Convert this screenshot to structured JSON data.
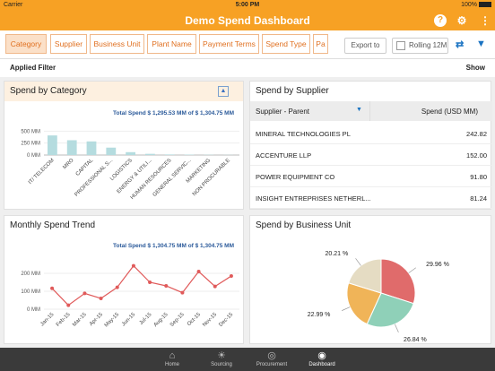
{
  "status": {
    "carrier": "Carrier",
    "time": "5:00 PM",
    "battery": "100%"
  },
  "header": {
    "title": "Demo Spend Dashboard",
    "icons": [
      "help-icon",
      "gear-icon",
      "more-vertical-icon"
    ],
    "accent": "#f7a124"
  },
  "filters": {
    "tabs": [
      "Category",
      "Supplier",
      "Business Unit",
      "Plant Name",
      "Payment Terms",
      "Spend Type",
      "Pa"
    ],
    "export_label": "Export to",
    "rolling_label": "Rolling 12M",
    "icons": [
      "swap-icon",
      "filter-icon"
    ]
  },
  "applied": {
    "label": "Applied Filter",
    "show_label": "Show"
  },
  "category_card": {
    "title": "Spend by Category",
    "total": "Total Spend $ 1,295.53 MM of $ 1,304.75 MM"
  },
  "supplier_card": {
    "title": "Spend by Supplier",
    "col1": "Supplier - Parent",
    "col2": "Spend (USD MM)",
    "rows": [
      {
        "name": "MINERAL TECHNOLOGIES PL",
        "value": "242.82"
      },
      {
        "name": "ACCENTURE LLP",
        "value": "152.00"
      },
      {
        "name": "POWER EQUIPMENT CO",
        "value": "91.80"
      },
      {
        "name": "INSIGHT ENTREPRISES NETHERL...",
        "value": "81.24"
      }
    ]
  },
  "trend_card": {
    "title": "Monthly Spend Trend",
    "total": "Total Spend $ 1,304.75 MM of $ 1,304.75 MM"
  },
  "bu_card": {
    "title": "Spend by Business Unit"
  },
  "chart_data": [
    {
      "type": "bar",
      "categories": [
        "IT/ TELECOM",
        "MRO",
        "CAPITAL",
        "PROFESSIONAL S...",
        "LOGISTICS",
        "ENERGY & UTILI...",
        "HUMAN RESOURCES",
        "GENERAL SERVIC...",
        "MARKETING",
        "NON PROCURABLE"
      ],
      "values": [
        410,
        310,
        285,
        155,
        60,
        25,
        12,
        8,
        5,
        3
      ],
      "yticks": [
        "0 MM",
        "250 MM",
        "500 MM"
      ],
      "ylim": [
        0,
        750
      ],
      "color": "#b5dcdf"
    },
    {
      "type": "line",
      "categories": [
        "Jan-15",
        "Feb-15",
        "Mar-15",
        "Apr-15",
        "May-15",
        "Jun-15",
        "Jul-15",
        "Aug-15",
        "Sep-15",
        "Oct-15",
        "Nov-15",
        "Dec-15"
      ],
      "values": [
        116,
        22,
        88,
        60,
        122,
        242,
        150,
        130,
        92,
        210,
        127,
        185
      ],
      "yticks": [
        "0 MM",
        "100 MM",
        "200 MM"
      ],
      "ylim": [
        0,
        300
      ],
      "color": "#e05a5a"
    },
    {
      "type": "pie",
      "slices": [
        {
          "label": "29.96 %",
          "value": 29.96,
          "color": "#e06b6b"
        },
        {
          "label": "26.84 %",
          "value": 26.84,
          "color": "#8fd0b8"
        },
        {
          "label": "22.99 %",
          "value": 22.99,
          "color": "#f0b458"
        },
        {
          "label": "20.21 %",
          "value": 20.21,
          "color": "#e5dcc3"
        }
      ]
    }
  ],
  "tabbar": {
    "items": [
      {
        "label": "Home",
        "icon": "home-icon"
      },
      {
        "label": "Sourcing",
        "icon": "sourcing-icon"
      },
      {
        "label": "Procurement",
        "icon": "procurement-icon"
      },
      {
        "label": "Dashboard",
        "icon": "dashboard-icon"
      }
    ]
  }
}
